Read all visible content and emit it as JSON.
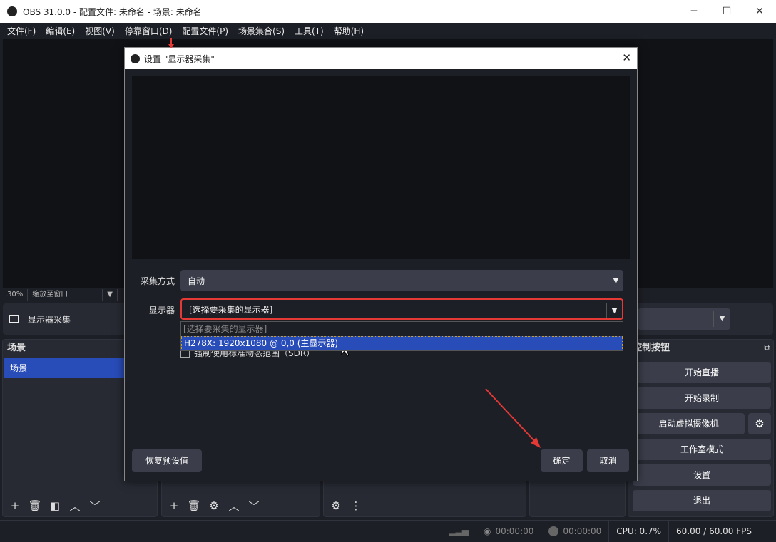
{
  "window": {
    "title": "OBS 31.0.0 - 配置文件: 未命名 - 场景: 未命名",
    "minimize": "─",
    "maximize": "☐",
    "close": "✕"
  },
  "menu": [
    "文件(F)",
    "编辑(E)",
    "视图(V)",
    "停靠窗口(D)",
    "配置文件(P)",
    "场景集合(S)",
    "工具(T)",
    "帮助(H)"
  ],
  "zoombar": {
    "percent": "30%",
    "mode": "缩放至窗口"
  },
  "source_bar": {
    "source_name": "显示器采集"
  },
  "scenes": {
    "title": "场景",
    "items": [
      "场景"
    ]
  },
  "controls": {
    "title": "控制按钮",
    "buttons": [
      "开始直播",
      "开始录制",
      "启动虚拟摄像机",
      "工作室模式",
      "设置",
      "退出"
    ]
  },
  "status": {
    "stream_time": "00:00:00",
    "record_time": "00:00:00",
    "cpu": "CPU: 0.7%",
    "fps": "60.00 / 60.00 FPS"
  },
  "dialog": {
    "title": "设置 \"显示器采集\"",
    "capture_method_label": "采集方式",
    "capture_method_value": "自动",
    "display_label": "显示器",
    "display_value": "[选择要采集的显示器]",
    "display_options": [
      "[选择要采集的显示器]",
      "H278X: 1920x1080 @ 0,0 (主显示器)"
    ],
    "sdr_checkbox": "强制使用标准动态范围（SDR）",
    "sdr_checked": false,
    "defaults_button": "恢复预设值",
    "ok_button": "确定",
    "cancel_button": "取消"
  },
  "colors": {
    "accent": "#284cb8",
    "highlight": "#e53935"
  }
}
